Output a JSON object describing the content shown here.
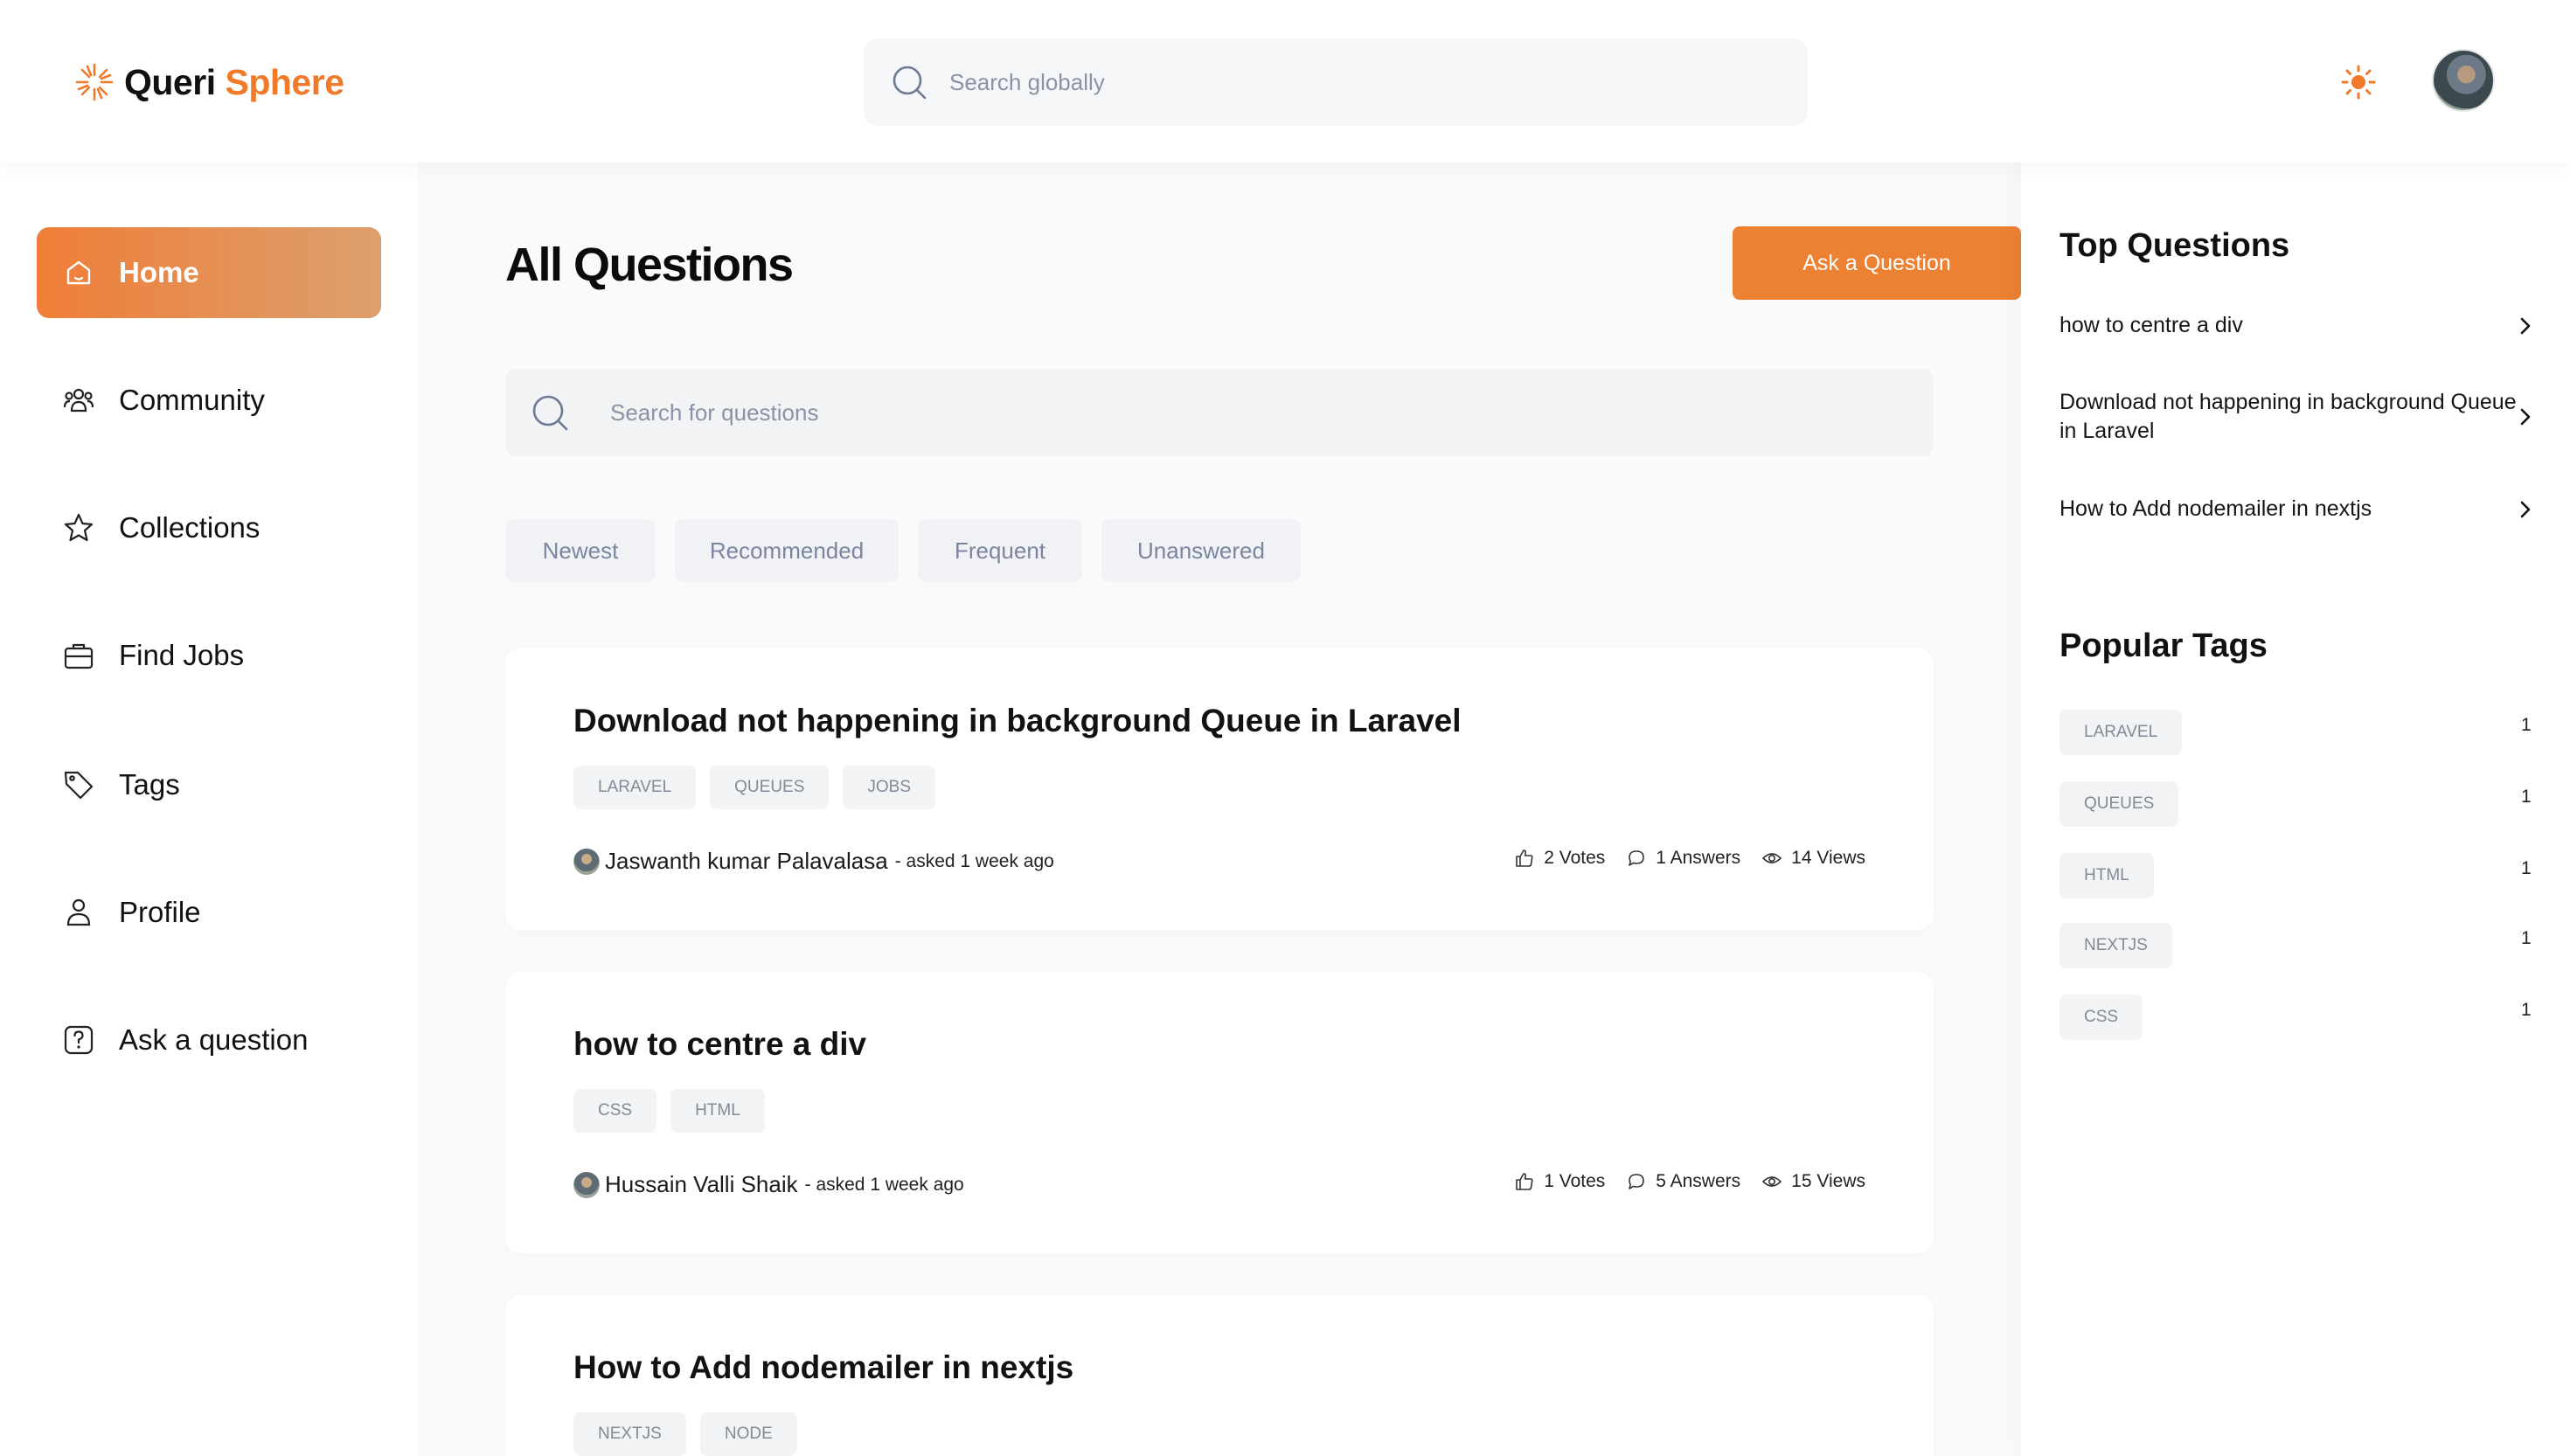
{
  "header": {
    "logo_primary": "Queri",
    "logo_accent": "Sphere",
    "search_placeholder": "Search globally",
    "theme_icon": "sun-icon",
    "avatar_icon": "user-avatar"
  },
  "sidebar": {
    "items": [
      {
        "label": "Home",
        "icon": "home-icon",
        "active": true
      },
      {
        "label": "Community",
        "icon": "users-icon",
        "active": false
      },
      {
        "label": "Collections",
        "icon": "star-icon",
        "active": false
      },
      {
        "label": "Find Jobs",
        "icon": "briefcase-icon",
        "active": false
      },
      {
        "label": "Tags",
        "icon": "tag-icon",
        "active": false
      },
      {
        "label": "Profile",
        "icon": "user-icon",
        "active": false
      },
      {
        "label": "Ask a question",
        "icon": "question-icon",
        "active": false
      }
    ]
  },
  "main": {
    "title": "All Questions",
    "ask_button": "Ask a Question",
    "search_placeholder": "Search for questions",
    "filters": [
      "Newest",
      "Recommended",
      "Frequent",
      "Unanswered"
    ],
    "questions": [
      {
        "title": "Download not happening in background Queue in Laravel",
        "tags": [
          "LARAVEL",
          "QUEUES",
          "JOBS"
        ],
        "author": "Jaswanth kumar Palavalasa",
        "asked": "- asked 1 week ago",
        "votes": "2 Votes",
        "answers": "1 Answers",
        "views": "14 Views"
      },
      {
        "title": "how to centre a div",
        "tags": [
          "CSS",
          "HTML"
        ],
        "author": "Hussain Valli Shaik",
        "asked": "- asked 1 week ago",
        "votes": "1 Votes",
        "answers": "5 Answers",
        "views": "15 Views"
      },
      {
        "title": "How to Add nodemailer in nextjs",
        "tags": [
          "NEXTJS",
          "NODE"
        ]
      }
    ]
  },
  "rightbar": {
    "top_title": "Top Questions",
    "top_questions": [
      "how to centre a div",
      "Download not happening in background Queue in Laravel",
      "How to Add nodemailer in nextjs"
    ],
    "tags_title": "Popular Tags",
    "popular_tags": [
      {
        "name": "LARAVEL",
        "count": "1"
      },
      {
        "name": "QUEUES",
        "count": "1"
      },
      {
        "name": "HTML",
        "count": "1"
      },
      {
        "name": "NEXTJS",
        "count": "1"
      },
      {
        "name": "CSS",
        "count": "1"
      }
    ]
  },
  "colors": {
    "accent": "#ec8133",
    "gradient_start": "#ef7d37",
    "gradient_end": "#dca06e",
    "chip_bg": "#f1f3f5",
    "chip_text": "#828a97"
  }
}
